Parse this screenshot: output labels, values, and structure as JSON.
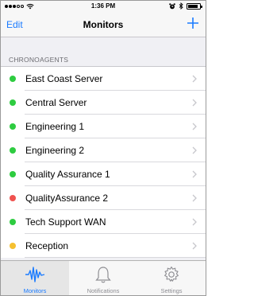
{
  "status_bar": {
    "signal_bars_filled": 3,
    "signal_bars_total": 5,
    "time": "1:36 PM",
    "battery_level": 0.85
  },
  "nav": {
    "left_label": "Edit",
    "title": "Monitors",
    "right_icon": "plus-icon"
  },
  "section": {
    "header": "CHRONOAGENTS"
  },
  "colors": {
    "accent": "#1a7bff",
    "status_green": "#2ecc40",
    "status_red": "#f0524f",
    "status_yellow": "#f5c030"
  },
  "monitors": [
    {
      "label": "East Coast Server",
      "status": "green"
    },
    {
      "label": "Central Server",
      "status": "green"
    },
    {
      "label": "Engineering 1",
      "status": "green"
    },
    {
      "label": "Engineering 2",
      "status": "green"
    },
    {
      "label": "Quality Assurance 1",
      "status": "green"
    },
    {
      "label": "QualityAssurance 2",
      "status": "red"
    },
    {
      "label": "Tech Support WAN",
      "status": "green"
    },
    {
      "label": "Reception",
      "status": "yellow"
    }
  ],
  "tabs": [
    {
      "label": "Monitors",
      "icon": "waveform-icon",
      "active": true
    },
    {
      "label": "Notifications",
      "icon": "bell-icon",
      "active": false
    },
    {
      "label": "Settings",
      "icon": "gear-icon",
      "active": false
    }
  ]
}
